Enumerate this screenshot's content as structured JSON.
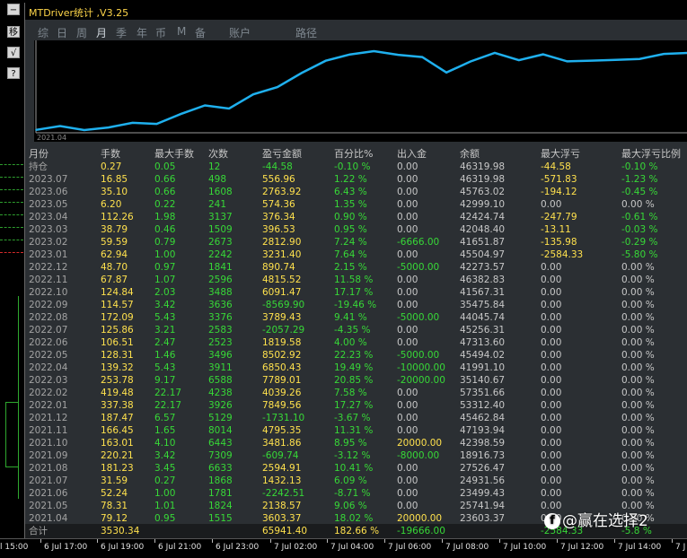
{
  "window": {
    "title": "MTDriver统计 ,V3.25"
  },
  "toolbar": {
    "buttons": [
      {
        "label": "−",
        "icon": "minimize-icon"
      },
      {
        "label": "移",
        "icon": "move-icon"
      },
      {
        "label": "√",
        "icon": "check-icon"
      },
      {
        "label": "?",
        "icon": "help-icon"
      }
    ]
  },
  "tabs": [
    "综",
    "日",
    "周",
    "月",
    "季",
    "年",
    "币",
    "M",
    "备",
    "账户",
    "路径"
  ],
  "active_tab": "月",
  "chart_data": {
    "type": "line",
    "x_start_label": "2021.04",
    "x": [
      "2021.04",
      "2021.05",
      "2021.06",
      "2021.07",
      "2021.08",
      "2021.09",
      "2021.10",
      "2021.11",
      "2021.12",
      "2022.01",
      "2022.02",
      "2022.03",
      "2022.04",
      "2022.05",
      "2022.06",
      "2022.07",
      "2022.08",
      "2022.09",
      "2022.10",
      "2022.11",
      "2022.12",
      "2023.01",
      "2023.02",
      "2023.03",
      "2023.04",
      "2023.05",
      "2023.06",
      "2023.07"
    ],
    "y": [
      3603.37,
      5741.94,
      3499.43,
      4931.56,
      7527.47,
      6916.51,
      12398.59,
      17193.94,
      15462.84,
      23312.4,
      27351.67,
      35140.67,
      41991.1,
      45494.02,
      47313.6,
      45256.31,
      44045.74,
      35475.84,
      41567.31,
      46382.83,
      42273.57,
      45504.97,
      41651.87,
      42048.4,
      42424.74,
      42999.1,
      45763.02,
      46319.98
    ],
    "color": "#1fb0ee",
    "grid": false
  },
  "table": {
    "headers": [
      "月份",
      "手数",
      "最大手数",
      "次数",
      "盈亏金额",
      "百分比%",
      "出入金",
      "余额",
      "最大浮亏",
      "最大浮亏比例"
    ],
    "rows": [
      [
        "持仓",
        "0.27",
        "0.05",
        "12",
        "-44.58",
        "-0.10 %",
        "0.00",
        "46319.98",
        "-44.58",
        "-0.10 %"
      ],
      [
        "2023.07",
        "16.85",
        "0.66",
        "498",
        "556.96",
        "1.22 %",
        "0.00",
        "46319.98",
        "-571.83",
        "-1.23 %"
      ],
      [
        "2023.06",
        "35.10",
        "0.66",
        "1608",
        "2763.92",
        "6.43 %",
        "0.00",
        "45763.02",
        "-194.12",
        "-0.45 %"
      ],
      [
        "2023.05",
        "6.20",
        "0.22",
        "241",
        "574.36",
        "1.35 %",
        "0.00",
        "42999.10",
        "0.00",
        "0.00 %"
      ],
      [
        "2023.04",
        "112.26",
        "1.98",
        "3137",
        "376.34",
        "0.90 %",
        "0.00",
        "42424.74",
        "-247.79",
        "-0.61 %"
      ],
      [
        "2023.03",
        "38.79",
        "0.46",
        "1509",
        "396.53",
        "0.95 %",
        "0.00",
        "42048.40",
        "-13.11",
        "-0.03 %"
      ],
      [
        "2023.02",
        "59.59",
        "0.79",
        "2673",
        "2812.90",
        "7.24 %",
        "-6666.00",
        "41651.87",
        "-135.98",
        "-0.29 %"
      ],
      [
        "2023.01",
        "62.94",
        "1.00",
        "2242",
        "3231.40",
        "7.64 %",
        "0.00",
        "45504.97",
        "-2584.33",
        "-5.80 %"
      ],
      [
        "2022.12",
        "48.70",
        "0.97",
        "1841",
        "890.74",
        "2.15 %",
        "-5000.00",
        "42273.57",
        "0.00",
        "0.00 %"
      ],
      [
        "2022.11",
        "67.87",
        "1.07",
        "2596",
        "4815.52",
        "11.58 %",
        "0.00",
        "46382.83",
        "0.00",
        "0.00 %"
      ],
      [
        "2022.10",
        "124.84",
        "2.03",
        "3488",
        "6091.47",
        "17.17 %",
        "0.00",
        "41567.31",
        "0.00",
        "0.00 %"
      ],
      [
        "2022.09",
        "114.57",
        "3.42",
        "3636",
        "-8569.90",
        "-19.46 %",
        "0.00",
        "35475.84",
        "0.00",
        "0.00 %"
      ],
      [
        "2022.08",
        "172.09",
        "5.43",
        "3376",
        "3789.43",
        "9.41 %",
        "-5000.00",
        "44045.74",
        "0.00",
        "0.00 %"
      ],
      [
        "2022.07",
        "125.86",
        "3.21",
        "2583",
        "-2057.29",
        "-4.35 %",
        "0.00",
        "45256.31",
        "0.00",
        "0.00 %"
      ],
      [
        "2022.06",
        "106.51",
        "2.47",
        "2523",
        "1819.58",
        "4.00 %",
        "0.00",
        "47313.60",
        "0.00",
        "0.00 %"
      ],
      [
        "2022.05",
        "128.31",
        "1.46",
        "3496",
        "8502.92",
        "22.23 %",
        "-5000.00",
        "45494.02",
        "0.00",
        "0.00 %"
      ],
      [
        "2022.04",
        "139.32",
        "5.43",
        "3911",
        "6850.43",
        "19.49 %",
        "-10000.00",
        "41991.10",
        "0.00",
        "0.00 %"
      ],
      [
        "2022.03",
        "253.78",
        "9.17",
        "6588",
        "7789.01",
        "20.85 %",
        "-20000.00",
        "35140.67",
        "0.00",
        "0.00 %"
      ],
      [
        "2022.02",
        "419.48",
        "22.17",
        "4238",
        "4039.26",
        "7.58 %",
        "0.00",
        "57351.66",
        "0.00",
        "0.00 %"
      ],
      [
        "2022.01",
        "337.38",
        "22.17",
        "3926",
        "7849.56",
        "17.27 %",
        "0.00",
        "53312.40",
        "0.00",
        "0.00 %"
      ],
      [
        "2021.12",
        "187.47",
        "6.57",
        "5129",
        "-1731.10",
        "-3.67 %",
        "0.00",
        "45462.84",
        "0.00",
        "0.00 %"
      ],
      [
        "2021.11",
        "166.45",
        "1.65",
        "8014",
        "4795.35",
        "11.31 %",
        "0.00",
        "47193.94",
        "0.00",
        "0.00 %"
      ],
      [
        "2021.10",
        "163.01",
        "4.10",
        "6443",
        "3481.86",
        "8.95 %",
        "20000.00",
        "42398.59",
        "0.00",
        "0.00 %"
      ],
      [
        "2021.09",
        "220.21",
        "3.42",
        "7309",
        "-609.74",
        "-3.12 %",
        "-8000.00",
        "18916.73",
        "0.00",
        "0.00 %"
      ],
      [
        "2021.08",
        "181.23",
        "3.45",
        "6633",
        "2594.91",
        "10.41 %",
        "0.00",
        "27526.47",
        "0.00",
        "0.00 %"
      ],
      [
        "2021.07",
        "31.59",
        "0.27",
        "1868",
        "1432.13",
        "6.09 %",
        "0.00",
        "24931.56",
        "0.00",
        "0.00 %"
      ],
      [
        "2021.06",
        "52.24",
        "1.00",
        "1781",
        "-2242.51",
        "-8.71 %",
        "0.00",
        "23499.43",
        "0.00",
        "0.00 %"
      ],
      [
        "2021.05",
        "78.31",
        "1.01",
        "1824",
        "2138.57",
        "9.06 %",
        "0.00",
        "25741.94",
        "0.00",
        "0.00 %"
      ],
      [
        "2021.04",
        "79.12",
        "0.95",
        "1515",
        "3603.37",
        "18.02 %",
        "20000.00",
        "23603.37",
        "0.00",
        "0.00 %"
      ]
    ],
    "totals": [
      "合计",
      "3530.34",
      "",
      "",
      "65941.40",
      "182.66 %",
      "-19666.00",
      "",
      "-2584.33",
      "-5.8 %"
    ]
  },
  "time_axis": [
    "l 15:00",
    "6 Jul 17:00",
    "6 Jul 19:00",
    "6 Jul 21:00",
    "6 Jul 23:00",
    "7 Jul 02:00",
    "7 Jul 04:00",
    "7 Jul 06:00",
    "7 Jul 08:00",
    "7 Jul 10:00",
    "7 Jul 12:00",
    "7 Jul 14:00",
    "7 J"
  ],
  "watermark": {
    "icon_text": "f",
    "text": "@赢在选择2"
  }
}
